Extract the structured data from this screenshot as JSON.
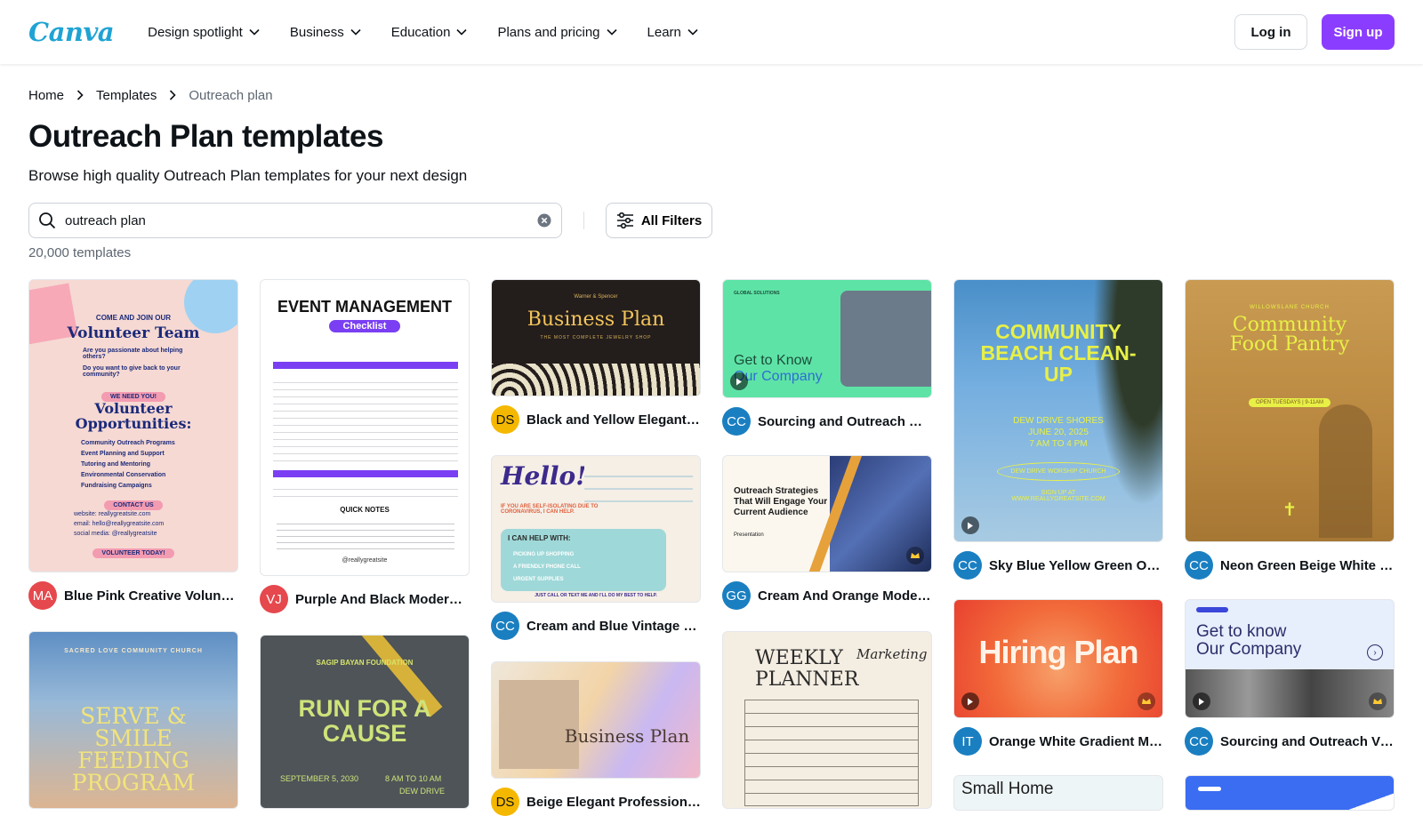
{
  "header": {
    "logo": "Canva",
    "nav": [
      "Design spotlight",
      "Business",
      "Education",
      "Plans and pricing",
      "Learn"
    ],
    "login_label": "Log in",
    "signup_label": "Sign up",
    "accent": "#8b3dff"
  },
  "breadcrumb": [
    "Home",
    "Templates",
    "Outreach plan"
  ],
  "page": {
    "title": "Outreach Plan templates",
    "subtitle": "Browse high quality Outreach Plan templates for your next design",
    "search_value": "outreach plan",
    "filters_label": "All Filters",
    "count": "20,000 templates"
  },
  "templates": [
    {
      "title": "Blue Pink Creative Volunteer Opportunities Flyer",
      "initials": "MA",
      "avatar_color": "#e5484d"
    },
    {
      "title": "Purple And Black Modern Event Management Checklist",
      "initials": "VJ",
      "avatar_color": "#e5484d"
    },
    {
      "title": "Black and Yellow Elegant Plan",
      "initials": "DS",
      "avatar_color": "#f5b800"
    },
    {
      "title": "Sourcing and Outreach Webinar",
      "initials": "CC",
      "avatar_color": "#1a7fc1"
    },
    {
      "title": "Sky Blue Yellow Green Outreach Poster",
      "initials": "CC",
      "avatar_color": "#1a7fc1"
    },
    {
      "title": "Neon Green Beige White Outreach Poster",
      "initials": "CC",
      "avatar_color": "#1a7fc1"
    },
    {
      "title": "Cream and Blue Vintage Self-Isolation Flyer",
      "initials": "CC",
      "avatar_color": "#1a7fc1"
    },
    {
      "title": "Cream And Orange Modern Presentation",
      "initials": "GG",
      "avatar_color": "#1a7fc1"
    },
    {
      "title": "Orange White Gradient Modern Video",
      "initials": "IT",
      "avatar_color": "#1a7fc1"
    },
    {
      "title": "Sourcing and Outreach Video",
      "initials": "CC",
      "avatar_color": "#1a7fc1"
    },
    {
      "title": "Beige Elegant Professional Plan",
      "initials": "DS",
      "avatar_color": "#f5b800"
    }
  ],
  "thumb_text": {
    "volunteer": {
      "top": "COME AND JOIN OUR",
      "heading": "Volunteer Team",
      "q1": "Are you passionate about helping others?",
      "q2": "Do you want to give back to your community?",
      "need": "WE NEED YOU!",
      "opp": "Volunteer Opportunities:",
      "items": [
        "Community Outreach Programs",
        "Event Planning and Support",
        "Tutoring and Mentoring",
        "Environmental Conservation",
        "Fundraising Campaigns"
      ],
      "contact": "CONTACT US",
      "website": "website: reallygreatsite.com",
      "email": "email: hello@reallygreatsite.com",
      "social": "social media: @reallygreatsite",
      "cta": "VOLUNTEER TODAY!"
    },
    "event": {
      "title": "EVENT MANAGEMENT",
      "badge": "Checklist",
      "quick": "QUICK NOTES",
      "handle": "@reallygreatsite"
    },
    "business": {
      "brand": "Warner & Spencer",
      "title": "Business Plan",
      "sub": "THE MOST COMPLETE JEWELRY SHOP"
    },
    "know": {
      "brand": "GLOBAL SOLUTIONS",
      "line1": "Get to Know",
      "line2": "Our Company"
    },
    "beach": {
      "title": "COMMUNITY BEACH CLEAN-UP",
      "place": "DEW DRIVE SHORES",
      "date": "JUNE 20, 2025",
      "time": "7 AM TO 4 PM",
      "church": "DEW DRIVE WORSHIP CHURCH",
      "signup": "SIGN UP AT WWW.REALLYGREATSITE.COM"
    },
    "pantry": {
      "church": "WILLOWSLANE CHURCH",
      "title": "Community Food Pantry",
      "open": "OPEN TUESDAYS | 9-11AM"
    },
    "hello": {
      "title": "Hello!",
      "iso": "IF YOU ARE SELF-ISOLATING DUE TO CORONAVIRUS, I CAN HELP.",
      "help": "I CAN HELP WITH:",
      "items": [
        "PICKING UP SHOPPING",
        "A FRIENDLY PHONE CALL",
        "URGENT SUPPLIES"
      ],
      "foot": "JUST CALL OR TEXT ME AND I'LL DO MY BEST TO HELP."
    },
    "strategies": {
      "title": "Outreach Strategies That Will Engage Your Current Audience",
      "sub": "Presentation"
    },
    "hiring": {
      "title": "Hiring Plan"
    },
    "company": {
      "line1": "Get to know",
      "line2": "Our Company"
    },
    "serve": {
      "church": "SACRED LOVE COMMUNITY CHURCH",
      "title": "SERVE & SMILE FEEDING PROGRAM"
    },
    "run": {
      "org": "SAGIP BAYAN FOUNDATION",
      "title": "RUN FOR A CAUSE",
      "date": "SEPTEMBER 5, 2030",
      "time": "8 AM TO 10 AM",
      "place": "DEW DRIVE"
    },
    "bizplan2": {
      "title": "Business Plan"
    },
    "weekly": {
      "title": "WEEKLY PLANNER",
      "script": "Marketing"
    },
    "smallhome": {
      "title": "Small Home"
    }
  }
}
